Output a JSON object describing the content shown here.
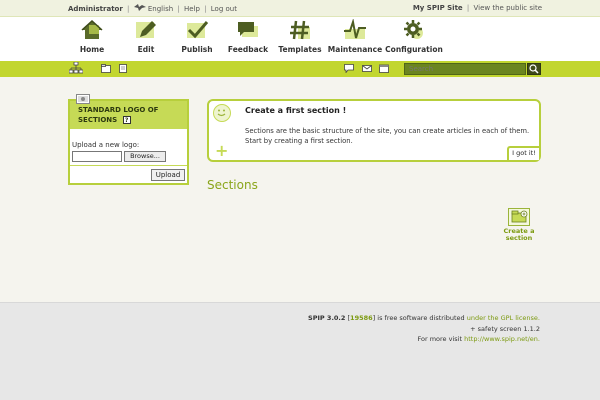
{
  "topbar": {
    "user": "Administrator",
    "language": "English",
    "help": "Help",
    "logout": "Log out",
    "site_name": "My SPIP Site",
    "view_public": "View the public site"
  },
  "nav": {
    "items": [
      {
        "label": "Home",
        "icon": "home-icon"
      },
      {
        "label": "Edit",
        "icon": "pencil-icon"
      },
      {
        "label": "Publish",
        "icon": "checkmark-icon"
      },
      {
        "label": "Feedback",
        "icon": "speech-bubble-icon"
      },
      {
        "label": "Templates",
        "icon": "hash-icon"
      },
      {
        "label": "Maintenance",
        "icon": "pulse-icon"
      },
      {
        "label": "Configuration",
        "icon": "gear-icon"
      }
    ]
  },
  "toolbar": {
    "search_placeholder": "Search"
  },
  "logo_box": {
    "title": "STANDARD LOGO OF SECTIONS",
    "help_label": "?",
    "upload_label": "Upload a new logo:",
    "browse_label": "Browse...",
    "upload_button": "Upload"
  },
  "info_box": {
    "title": "Create a first section !",
    "body": "Sections are the basic structure of the site, you can create articles in each of them. Start by creating a first section.",
    "got_it": "I got it!"
  },
  "sections": {
    "title": "Sections",
    "create_label": "Create a section"
  },
  "footer": {
    "spip_version": "SPIP 3.0.2",
    "revision": "19586",
    "free_software_text": "is free software distributed",
    "license_link": "under the GPL license.",
    "safety_screen": "+ safety screen 1.1.2",
    "more_info_text": "For more visit",
    "more_info_link": "http://www.spip.net/en."
  },
  "colors": {
    "accent_green": "#c2d62f",
    "link_green": "#7c9a10"
  }
}
